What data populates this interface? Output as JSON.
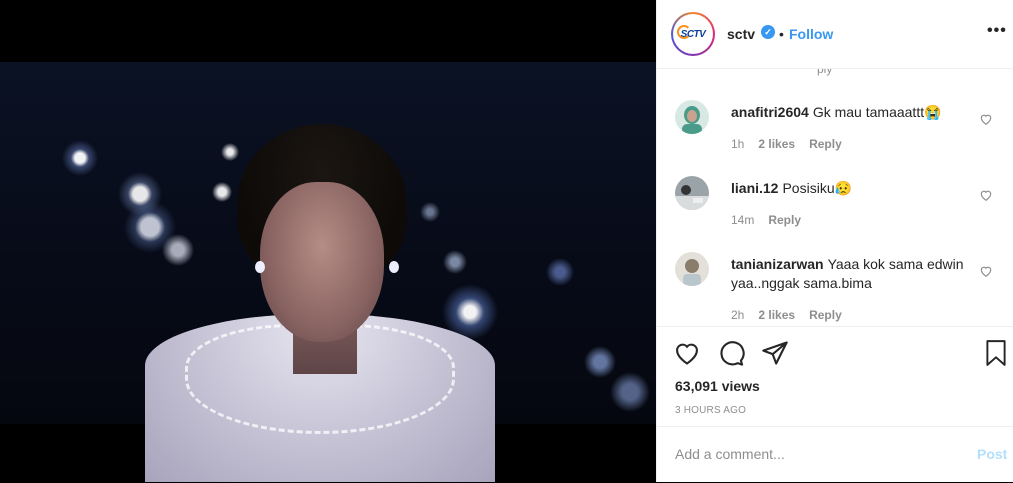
{
  "header": {
    "username": "sctv",
    "logo_text": "SCTV",
    "verified_symbol": "✓",
    "separator": "•",
    "follow_label": "Follow",
    "more_symbol": "•••"
  },
  "comments": [
    {
      "username": "anafitri2604",
      "text": "Gk mau tamaaattt😭",
      "time": "1h",
      "likes": "2 likes",
      "reply": "Reply"
    },
    {
      "username": "liani.12",
      "text": "Posisiku😥",
      "time": "14m",
      "likes": "",
      "reply": "Reply"
    },
    {
      "username": "tanianizarwan",
      "text": "Yaaa kok sama edwin yaa..nggak sama.bima",
      "time": "2h",
      "likes": "2 likes",
      "reply": "Reply"
    }
  ],
  "previous_reply": "ply",
  "stats": {
    "views": "63,091 views",
    "time_ago": "3 HOURS AGO"
  },
  "add_comment": {
    "placeholder": "Add a comment...",
    "post_label": "Post"
  },
  "icons": {
    "like": "heart-icon",
    "comment": "comment-icon",
    "share": "share-icon",
    "save": "bookmark-icon",
    "more": "more-options-icon",
    "verified": "verified-badge-icon"
  },
  "colors": {
    "accent": "#3897f0",
    "post_disabled": "#b2dffc",
    "muted": "#8e8e8e"
  }
}
